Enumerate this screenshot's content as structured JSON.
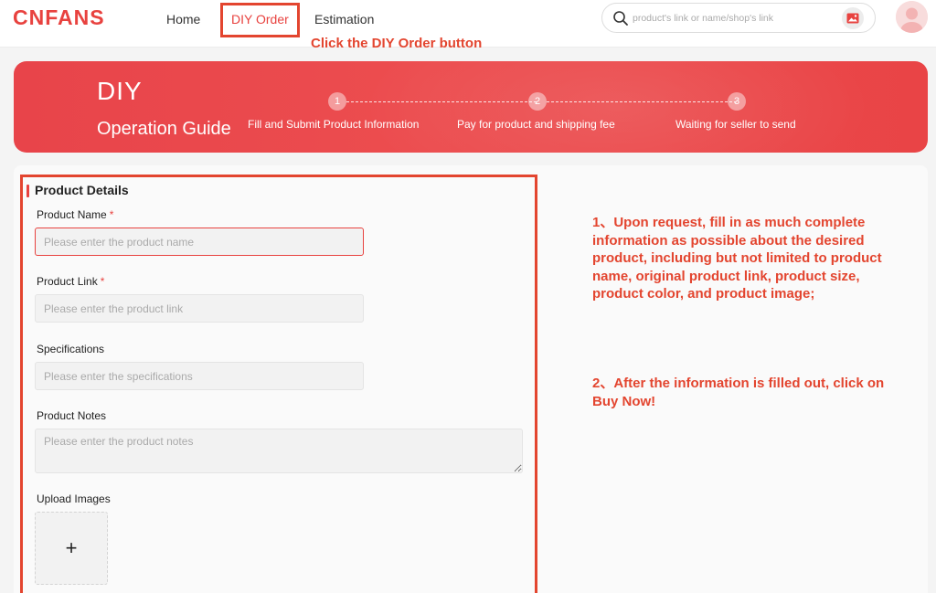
{
  "brand": {
    "logo_text": "CNFANS",
    "accent_color": "#e8423f",
    "annotation_color": "#e3452f"
  },
  "nav": {
    "items": [
      {
        "label": "Home"
      },
      {
        "label": "DIY Order",
        "active": true
      },
      {
        "label": "Estimation"
      }
    ],
    "callout": "Click the DIY Order button"
  },
  "search": {
    "placeholder": "product's link or name/shop's link",
    "icon": "search-icon",
    "image_search_icon": "image-search-icon"
  },
  "user": {
    "avatar_icon": "avatar"
  },
  "banner": {
    "title": "DIY",
    "subtitle": "Operation Guide",
    "steps": [
      {
        "number": "1",
        "label": "Fill and Submit Product Information"
      },
      {
        "number": "2",
        "label": "Pay for product and shipping fee"
      },
      {
        "number": "3",
        "label": "Waiting for seller to send"
      }
    ]
  },
  "form": {
    "section_title": "Product Details",
    "fields": [
      {
        "label": "Product Name",
        "required": "*",
        "placeholder": "Please enter the product name",
        "value": ""
      },
      {
        "label": "Product Link",
        "required": "*",
        "placeholder": "Please enter the product link",
        "value": ""
      },
      {
        "label": "Specifications",
        "placeholder": "Please enter the specifications",
        "value": ""
      },
      {
        "label": "Product Notes",
        "placeholder": "Please enter the product notes",
        "value": ""
      }
    ],
    "upload": {
      "label": "Upload Images",
      "button": "+"
    }
  },
  "instructions": [
    "1、Upon request, fill in as much complete information as possible about the desired product, including but not limited to product name, original product link, product size, product color, and product image;",
    "2、After the information is filled out, click on Buy Now!"
  ]
}
